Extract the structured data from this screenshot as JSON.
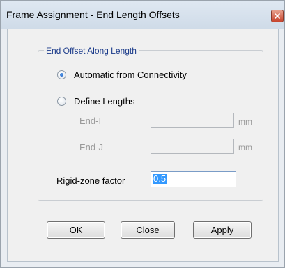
{
  "window": {
    "title": "Frame Assignment - End Length Offsets"
  },
  "group": {
    "legend": "End Offset Along Length",
    "options": [
      {
        "label": "Automatic from Connectivity",
        "selected": true
      },
      {
        "label": "Define Lengths",
        "selected": false
      }
    ],
    "end_i": {
      "label": "End-I",
      "value": "",
      "unit": "mm",
      "enabled": false
    },
    "end_j": {
      "label": "End-J",
      "value": "",
      "unit": "mm",
      "enabled": false
    },
    "rigid_zone": {
      "label": "Rigid-zone factor",
      "value": "0.5"
    }
  },
  "buttons": {
    "ok": "OK",
    "close": "Close",
    "apply": "Apply"
  },
  "icons": {
    "close": "close-icon"
  },
  "colors": {
    "legend": "#1a3a8a",
    "selection": "#3399ff",
    "disabled_text": "#9a9a9a"
  }
}
